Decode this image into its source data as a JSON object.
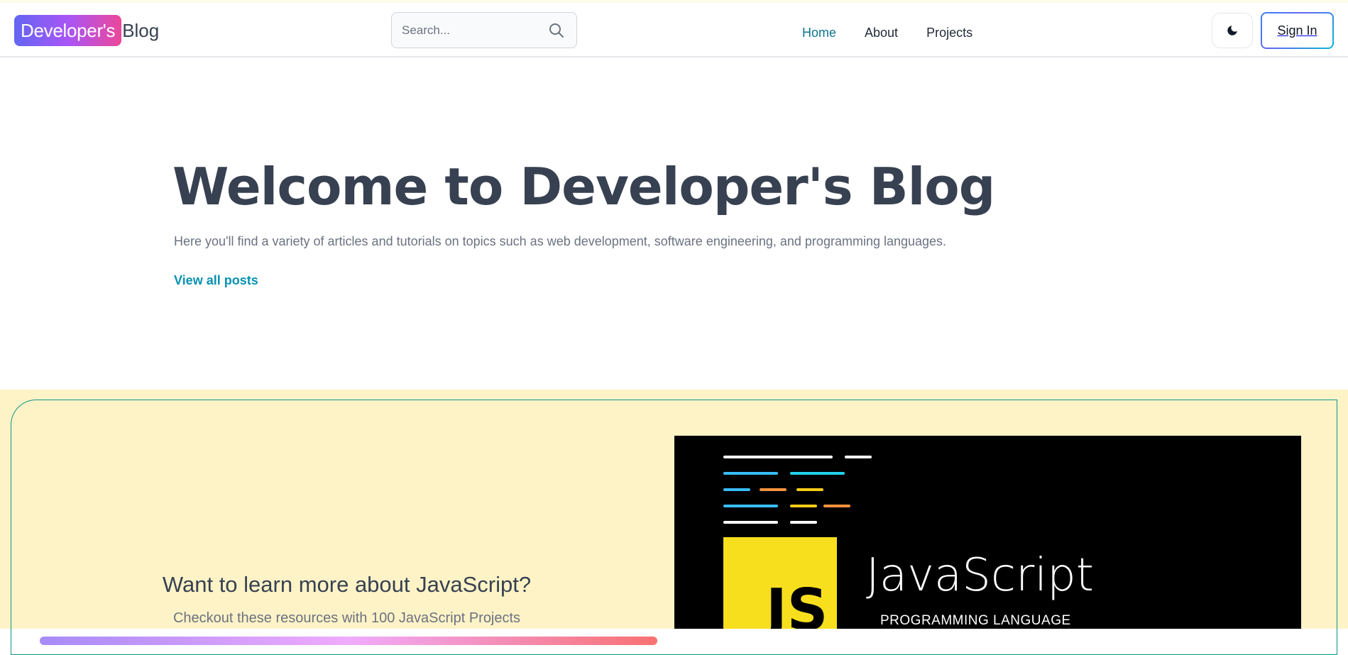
{
  "brand": {
    "highlight": "Developer's",
    "rest": "Blog"
  },
  "search": {
    "placeholder": "Search..."
  },
  "nav": {
    "items": [
      {
        "label": "Home"
      },
      {
        "label": "About"
      },
      {
        "label": "Projects"
      }
    ],
    "active": "Home"
  },
  "header_actions": {
    "theme_icon": "moon-icon",
    "signin_label": "Sign In"
  },
  "hero": {
    "title": "Welcome to Developer's Blog",
    "description": "Here you'll find a variety of articles and tutorials on topics such as web development, software engineering, and programming languages.",
    "link": "View all posts"
  },
  "promo": {
    "heading": "Want to learn more about JavaScript?",
    "subheading": "Checkout these resources with 100 JavaScript Projects",
    "image": {
      "logo_text": "JS",
      "title": "JavaScript",
      "caption": "PROGRAMMING LANGUAGE"
    }
  },
  "colors": {
    "accent": "#0e7490",
    "link": "#0891b2",
    "promo_background": "#fef3c7",
    "promo_border": "#0d9488",
    "js_yellow": "#f7df1e"
  }
}
